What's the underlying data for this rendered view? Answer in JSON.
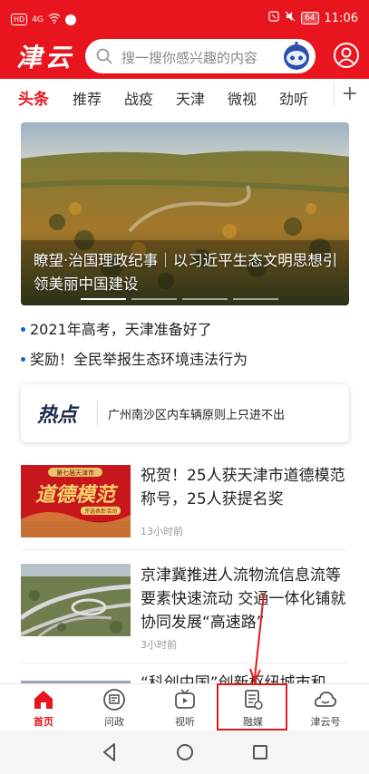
{
  "status_bar": {
    "sim_badge": "HD",
    "network": "4G",
    "battery": "64",
    "time": "11:06"
  },
  "header": {
    "logo": "津云",
    "search_placeholder": "搜一搜你感兴趣的内容"
  },
  "tabs": [
    "头条",
    "推荐",
    "战疫",
    "天津",
    "微视",
    "劲听"
  ],
  "tab_plus": "+",
  "hero": {
    "caption": "瞭望·治国理政纪事｜以习近平生态文明思想引领美丽中国建设"
  },
  "headlines": [
    "2021年高考，天津准备好了",
    "奖励！全民举报生态环境违法行为"
  ],
  "hot": {
    "logo": "热点",
    "text": "广州南沙区内车辆原则上只进不出"
  },
  "news": [
    {
      "title": "祝贺！25人获天津市道德模范称号，25人获提名奖",
      "time": "13小时前",
      "thumb_banner": "第七届天津市",
      "thumb_title": "道德模范",
      "thumb_sub": "评选表彰活动"
    },
    {
      "title": "京津冀推进人流物流信息流等要素快速流动 交通一体化铺就协同发展“高速路”",
      "time": "3小时前"
    },
    {
      "title": "“科创中国”创新枢纽城市和"
    }
  ],
  "bottom_nav": [
    {
      "label": "首页",
      "icon": "home-icon"
    },
    {
      "label": "问政",
      "icon": "ask-icon"
    },
    {
      "label": "视听",
      "icon": "tv-icon"
    },
    {
      "label": "融媒",
      "icon": "media-icon"
    },
    {
      "label": "津云号",
      "icon": "cloud-icon"
    }
  ],
  "colors": {
    "brand": "#e8151e",
    "bullet": "#1b5fd6",
    "annotation": "#e21b1b"
  }
}
